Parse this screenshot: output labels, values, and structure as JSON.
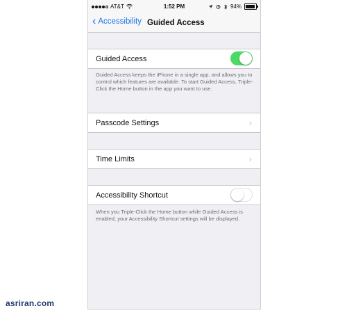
{
  "statusbar": {
    "carrier": "AT&T",
    "time": "1:52 PM",
    "battery": "94%",
    "battery_level": 0.94,
    "icons": [
      "signal-dots-icon",
      "wifi-icon",
      "location-arrow-icon",
      "alarm-icon",
      "bluetooth-icon",
      "battery-icon"
    ]
  },
  "navbar": {
    "back_label": "Accessibility",
    "title": "Guided Access"
  },
  "guided_access": {
    "label": "Guided Access",
    "enabled": true,
    "footer": "Guided Access keeps the iPhone in a single app, and allows you to control which features are available. To start Guided Access, Triple-Click the Home button in the app you want to use."
  },
  "rows": {
    "passcode": "Passcode Settings",
    "time_limits": "Time Limits"
  },
  "shortcut": {
    "label": "Accessibility Shortcut",
    "enabled": false,
    "footer": "When you Triple-Click the Home button while Guided Access is enabled, your Accessibility Shortcut settings will be displayed."
  },
  "watermark": "asriran.com",
  "colors": {
    "accent": "#1a73e8",
    "toggle_on": "#4cd964",
    "background": "#efeff4"
  }
}
